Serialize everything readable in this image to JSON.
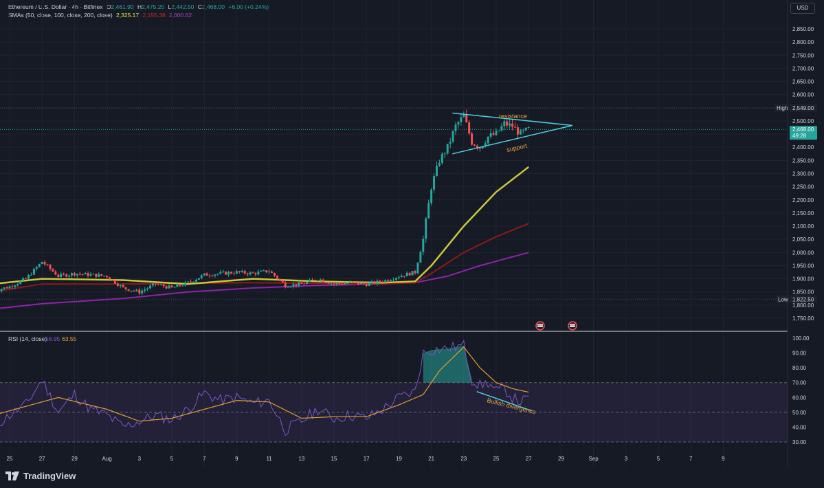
{
  "header": {
    "symbol": "Ethereum / U.S. Dollar · 4h · Bitfinex",
    "open_label": "O",
    "open": "2,461.90",
    "high_label": "H",
    "high": "2,475.20",
    "low_label": "L",
    "low": "2,442.50",
    "close_label": "C",
    "close": "2,468.00",
    "change": "+6.00 (+0.24%)",
    "sma_label": "SMAs (50, close, 100, close, 200, close)",
    "sma50_value": "2,325.17",
    "sma100_value": "2,155.38",
    "sma200_value": "2,000.62"
  },
  "currency_button": "USD",
  "price_axis": {
    "ticks": [
      "2,850.00",
      "2,800.00",
      "2,750.00",
      "2,700.00",
      "2,650.00",
      "2,600.00",
      "2,550.00",
      "2,500.00",
      "2,450.00",
      "2,400.00",
      "2,350.00",
      "2,300.00",
      "2,250.00",
      "2,200.00",
      "2,150.00",
      "2,100.00",
      "2,050.00",
      "2,000.00",
      "1,950.00",
      "1,900.00",
      "1,850.00",
      "1,800.00",
      "1,750.00"
    ],
    "high_tag": "High",
    "high_value": "2,549.00",
    "low_tag": "Low",
    "low_value": "1,822.50",
    "current_price": "2,468.00",
    "countdown": "49:28"
  },
  "rsi": {
    "label": "RSI (14, close)",
    "rsi_value": "58.95",
    "ma_value": "63.55",
    "ticks": [
      "100.00",
      "90.00",
      "80.00",
      "70.00",
      "60.00",
      "50.00",
      "40.00",
      "30.00"
    ]
  },
  "time_axis": [
    "25",
    "27",
    "29",
    "Aug",
    "3",
    "5",
    "7",
    "9",
    "11",
    "13",
    "15",
    "17",
    "19",
    "21",
    "23",
    "25",
    "27",
    "29",
    "Sep",
    "3",
    "5",
    "7",
    "9"
  ],
  "annotations": {
    "resistance": "resistance",
    "support": "support",
    "divergence": "Bullish divergence"
  },
  "brand": "TradingView",
  "colors": {
    "up": "#26a69a",
    "down": "#ef5350",
    "sma50": "#c8c83a",
    "sma100": "#8b1a1a",
    "sma200": "#8e24aa",
    "rsi_line": "#7e57c2",
    "rsi_ma": "#e0a030",
    "trendline": "#4dd0e1",
    "annotation_text": "#e6a23c"
  },
  "chart_data": {
    "type": "candlestick",
    "title": "Ethereum / U.S. Dollar · 4h · Bitfinex",
    "ylim": [
      1725,
      2875
    ],
    "price_high": 2549.0,
    "price_low": 1822.5,
    "last_price": 2468.0,
    "close_path": [
      {
        "x": "Jul 24",
        "y": 1855
      },
      {
        "x": "Jul 25",
        "y": 1870
      },
      {
        "x": "Jul 26",
        "y": 1900
      },
      {
        "x": "Jul 27",
        "y": 1965
      },
      {
        "x": "Jul 28",
        "y": 1910
      },
      {
        "x": "Jul 29",
        "y": 1920
      },
      {
        "x": "Jul 30",
        "y": 1915
      },
      {
        "x": "Jul 31",
        "y": 1910
      },
      {
        "x": "Aug 1",
        "y": 1865
      },
      {
        "x": "Aug 2",
        "y": 1850
      },
      {
        "x": "Aug 3",
        "y": 1880
      },
      {
        "x": "Aug 4",
        "y": 1865
      },
      {
        "x": "Aug 5",
        "y": 1885
      },
      {
        "x": "Aug 6",
        "y": 1915
      },
      {
        "x": "Aug 7",
        "y": 1920
      },
      {
        "x": "Aug 8",
        "y": 1925
      },
      {
        "x": "Aug 9",
        "y": 1920
      },
      {
        "x": "Aug 10",
        "y": 1930
      },
      {
        "x": "Aug 11",
        "y": 1875
      },
      {
        "x": "Aug 12",
        "y": 1880
      },
      {
        "x": "Aug 13",
        "y": 1900
      },
      {
        "x": "Aug 14",
        "y": 1880
      },
      {
        "x": "Aug 15",
        "y": 1885
      },
      {
        "x": "Aug 16",
        "y": 1880
      },
      {
        "x": "Aug 17",
        "y": 1890
      },
      {
        "x": "Aug 18",
        "y": 1910
      },
      {
        "x": "Aug 19",
        "y": 1925
      },
      {
        "x": "Aug 19.5",
        "y": 2050
      },
      {
        "x": "Aug 20",
        "y": 2250
      },
      {
        "x": "Aug 20.5",
        "y": 2350
      },
      {
        "x": "Aug 21",
        "y": 2400
      },
      {
        "x": "Aug 21.5",
        "y": 2480
      },
      {
        "x": "Aug 22",
        "y": 2520
      },
      {
        "x": "Aug 22.5",
        "y": 2420
      },
      {
        "x": "Aug 23",
        "y": 2400
      },
      {
        "x": "Aug 23.5",
        "y": 2440
      },
      {
        "x": "Aug 24",
        "y": 2450
      },
      {
        "x": "Aug 24.5",
        "y": 2490
      },
      {
        "x": "Aug 25",
        "y": 2480
      },
      {
        "x": "Aug 25.5",
        "y": 2450
      },
      {
        "x": "Aug 26",
        "y": 2468
      }
    ],
    "sma50": [
      {
        "x": "Jul 24",
        "y": 1880
      },
      {
        "x": "Jul 27",
        "y": 1900
      },
      {
        "x": "Aug 1",
        "y": 1895
      },
      {
        "x": "Aug 5",
        "y": 1880
      },
      {
        "x": "Aug 9",
        "y": 1900
      },
      {
        "x": "Aug 13",
        "y": 1890
      },
      {
        "x": "Aug 17",
        "y": 1885
      },
      {
        "x": "Aug 19",
        "y": 1890
      },
      {
        "x": "Aug 20",
        "y": 1950
      },
      {
        "x": "Aug 22",
        "y": 2100
      },
      {
        "x": "Aug 24",
        "y": 2230
      },
      {
        "x": "Aug 26",
        "y": 2325
      }
    ],
    "sma100": [
      {
        "x": "Jul 24",
        "y": 1850
      },
      {
        "x": "Jul 27",
        "y": 1880
      },
      {
        "x": "Aug 1",
        "y": 1880
      },
      {
        "x": "Aug 9",
        "y": 1885
      },
      {
        "x": "Aug 17",
        "y": 1880
      },
      {
        "x": "Aug 19",
        "y": 1885
      },
      {
        "x": "Aug 20",
        "y": 1920
      },
      {
        "x": "Aug 22",
        "y": 2000
      },
      {
        "x": "Aug 24",
        "y": 2060
      },
      {
        "x": "Aug 26",
        "y": 2110
      }
    ],
    "sma200": [
      {
        "x": "Jul 24",
        "y": 1785
      },
      {
        "x": "Jul 27",
        "y": 1805
      },
      {
        "x": "Aug 1",
        "y": 1825
      },
      {
        "x": "Aug 5",
        "y": 1850
      },
      {
        "x": "Aug 9",
        "y": 1865
      },
      {
        "x": "Aug 13",
        "y": 1875
      },
      {
        "x": "Aug 17",
        "y": 1880
      },
      {
        "x": "Aug 19",
        "y": 1885
      },
      {
        "x": "Aug 21",
        "y": 1910
      },
      {
        "x": "Aug 23",
        "y": 1950
      },
      {
        "x": "Aug 26",
        "y": 2000
      }
    ],
    "triangle": {
      "resistance": [
        {
          "x": "Aug 21.3",
          "y": 2530
        },
        {
          "x": "Aug 28.7",
          "y": 2483
        }
      ],
      "support": [
        {
          "x": "Aug 21.3",
          "y": 2375
        },
        {
          "x": "Aug 28.7",
          "y": 2483
        }
      ]
    },
    "rsi_ylim": [
      25,
      102
    ],
    "rsi_bands": [
      30,
      50,
      70
    ],
    "rsi_path": [
      {
        "x": "Jul 24",
        "y": 40
      },
      {
        "x": "Jul 25",
        "y": 48
      },
      {
        "x": "Jul 26",
        "y": 55
      },
      {
        "x": "Jul 27",
        "y": 72
      },
      {
        "x": "Jul 28",
        "y": 50
      },
      {
        "x": "Jul 29",
        "y": 62
      },
      {
        "x": "Jul 30",
        "y": 52
      },
      {
        "x": "Jul 31",
        "y": 48
      },
      {
        "x": "Aug 1",
        "y": 40
      },
      {
        "x": "Aug 2",
        "y": 44
      },
      {
        "x": "Aug 3",
        "y": 48
      },
      {
        "x": "Aug 4",
        "y": 45
      },
      {
        "x": "Aug 5",
        "y": 52
      },
      {
        "x": "Aug 6",
        "y": 63
      },
      {
        "x": "Aug 7",
        "y": 58
      },
      {
        "x": "Aug 8",
        "y": 60
      },
      {
        "x": "Aug 9",
        "y": 56
      },
      {
        "x": "Aug 10",
        "y": 58
      },
      {
        "x": "Aug 11",
        "y": 38
      },
      {
        "x": "Aug 12",
        "y": 44
      },
      {
        "x": "Aug 13",
        "y": 52
      },
      {
        "x": "Aug 14",
        "y": 46
      },
      {
        "x": "Aug 15",
        "y": 48
      },
      {
        "x": "Aug 16",
        "y": 46
      },
      {
        "x": "Aug 17",
        "y": 52
      },
      {
        "x": "Aug 18",
        "y": 60
      },
      {
        "x": "Aug 19",
        "y": 64
      },
      {
        "x": "Aug 19.5",
        "y": 90
      },
      {
        "x": "Aug 20",
        "y": 92
      },
      {
        "x": "Aug 21",
        "y": 93
      },
      {
        "x": "Aug 22",
        "y": 95
      },
      {
        "x": "Aug 22.5",
        "y": 72
      },
      {
        "x": "Aug 23",
        "y": 68
      },
      {
        "x": "Aug 23.5",
        "y": 70
      },
      {
        "x": "Aug 24",
        "y": 64
      },
      {
        "x": "Aug 24.5",
        "y": 66
      },
      {
        "x": "Aug 25",
        "y": 60
      },
      {
        "x": "Aug 25.5",
        "y": 57
      },
      {
        "x": "Aug 26",
        "y": 58.95
      }
    ],
    "rsi_ma_path": [
      {
        "x": "Jul 24",
        "y": 48
      },
      {
        "x": "Jul 26",
        "y": 54
      },
      {
        "x": "Jul 28",
        "y": 60
      },
      {
        "x": "Jul 31",
        "y": 52
      },
      {
        "x": "Aug 2",
        "y": 44
      },
      {
        "x": "Aug 4",
        "y": 46
      },
      {
        "x": "Aug 6",
        "y": 52
      },
      {
        "x": "Aug 8",
        "y": 58
      },
      {
        "x": "Aug 10",
        "y": 57
      },
      {
        "x": "Aug 12",
        "y": 46
      },
      {
        "x": "Aug 14",
        "y": 47
      },
      {
        "x": "Aug 16",
        "y": 47
      },
      {
        "x": "Aug 18",
        "y": 55
      },
      {
        "x": "Aug 19.5",
        "y": 62
      },
      {
        "x": "Aug 20.5",
        "y": 78
      },
      {
        "x": "Aug 22",
        "y": 94
      },
      {
        "x": "Aug 23",
        "y": 80
      },
      {
        "x": "Aug 24",
        "y": 70
      },
      {
        "x": "Aug 25",
        "y": 66
      },
      {
        "x": "Aug 26",
        "y": 63.55
      }
    ],
    "divergence_line": [
      {
        "x": "Aug 22.8",
        "y": 64
      },
      {
        "x": "Aug 26.2",
        "y": 51
      }
    ]
  }
}
